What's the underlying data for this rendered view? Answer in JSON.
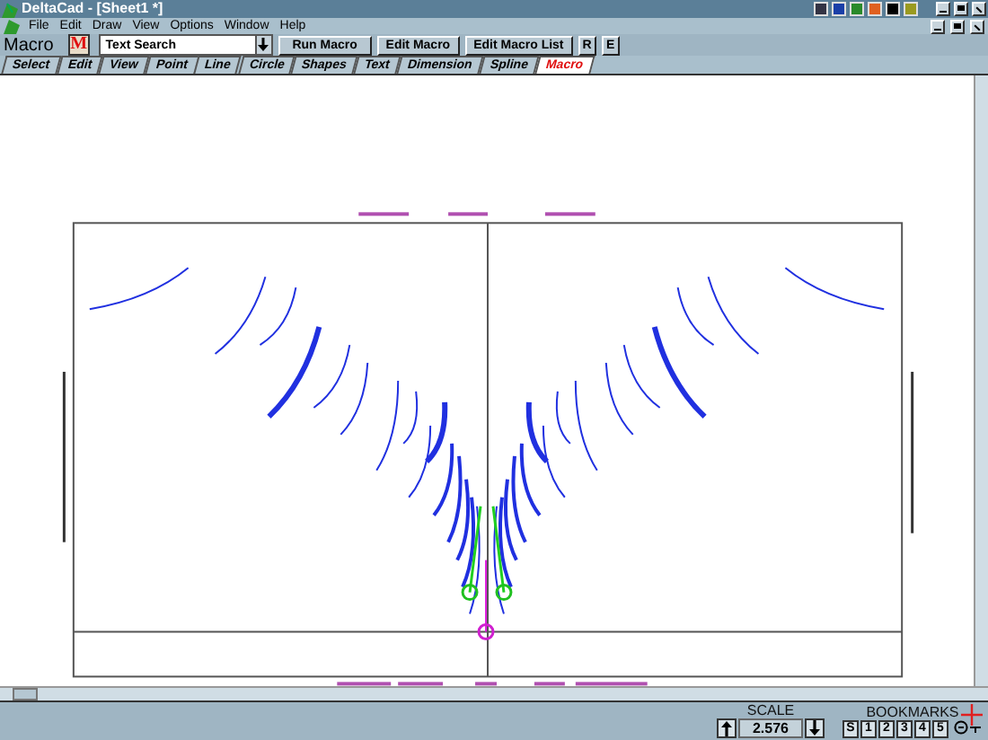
{
  "window": {
    "title": "DeltaCad - [Sheet1 *]"
  },
  "menu": [
    "File",
    "Edit",
    "Draw",
    "View",
    "Options",
    "Window",
    "Help"
  ],
  "toolbar": {
    "label": "Macro",
    "icon_letter": "M",
    "macro_select": {
      "value": "Text Search"
    },
    "buttons": [
      "Run Macro",
      "Edit Macro",
      "Edit Macro List",
      "R",
      "E"
    ]
  },
  "tabs": [
    {
      "label": "Select",
      "selected": false
    },
    {
      "label": "Edit",
      "selected": false
    },
    {
      "label": "View",
      "selected": false
    },
    {
      "label": "Point",
      "selected": false
    },
    {
      "label": "Line",
      "selected": false
    },
    {
      "label": "Circle",
      "selected": false
    },
    {
      "label": "Shapes",
      "selected": false
    },
    {
      "label": "Text",
      "selected": false
    },
    {
      "label": "Dimension",
      "selected": false
    },
    {
      "label": "Spline",
      "selected": false
    },
    {
      "label": "Macro",
      "selected": true
    }
  ],
  "status_bar": {
    "scale_label": "SCALE",
    "scale_value": "2.576",
    "bookmarks_label": "BOOKMARKS",
    "bookmarks": [
      "S",
      "1",
      "2",
      "3",
      "4",
      "5"
    ]
  }
}
